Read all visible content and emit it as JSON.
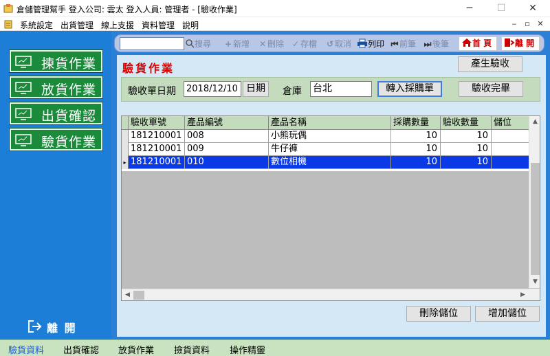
{
  "window": {
    "title": "倉儲管理幫手  登入公司: 雲太  登入人員: 管理者 - [驗收作業]",
    "min_glyph": "─",
    "max_glyph": "☐",
    "close_glyph": "✕"
  },
  "menu": {
    "items": [
      "系統設定",
      "出貨管理",
      "線上支援",
      "資料管理",
      "說明"
    ],
    "mdi_min": "‒",
    "mdi_restore": "▫",
    "mdi_close": "✕"
  },
  "sidebar": {
    "items": [
      {
        "label": "揀貨作業",
        "icon": "monitor-icon"
      },
      {
        "label": "放貨作業",
        "icon": "monitor-icon"
      },
      {
        "label": "出貨確認",
        "icon": "monitor-icon"
      },
      {
        "label": "驗貨作業",
        "icon": "monitor-icon"
      }
    ],
    "exit_label": "離 開"
  },
  "toolbar": {
    "search_value": "",
    "search_label": "搜尋",
    "new_label": "新增",
    "delete_label": "刪除",
    "save_label": "存檔",
    "cancel_label": "取消",
    "print_label": "列印",
    "prev_label": "前筆",
    "next_label": "後筆",
    "home_label": "首 頁",
    "exit_label": "離 開"
  },
  "page": {
    "title": "驗貨作業",
    "generate_button": "產生驗收"
  },
  "filter": {
    "date_label": "驗收單日期",
    "date_value": "2018/12/10",
    "date_button": "日期",
    "warehouse_label": "倉庫",
    "warehouse_value": "台北",
    "transfer_button": "轉入採購單",
    "complete_button": "驗收完畢"
  },
  "grid": {
    "columns": [
      "驗收單號",
      "產品編號",
      "產品名稱",
      "採購數量",
      "驗收數量",
      "儲位"
    ],
    "rows": [
      {
        "order_no": "181210001",
        "product_no": "008",
        "product_name": "小熊玩偶",
        "purchase_qty": "10",
        "receive_qty": "10",
        "location": "",
        "selected": false
      },
      {
        "order_no": "181210001",
        "product_no": "009",
        "product_name": "牛仔褲",
        "purchase_qty": "10",
        "receive_qty": "10",
        "location": "",
        "selected": false
      },
      {
        "order_no": "181210001",
        "product_no": "010",
        "product_name": "數位相機",
        "purchase_qty": "10",
        "receive_qty": "10",
        "location": "",
        "selected": true
      }
    ],
    "current_row_marker": "▸"
  },
  "actions": {
    "delete_location": "刪除儲位",
    "add_location": "增加儲位"
  },
  "statusbar": {
    "items": [
      "驗貨資料",
      "出貨確認",
      "放貨作業",
      "撿貨資料",
      "操作精靈"
    ]
  }
}
